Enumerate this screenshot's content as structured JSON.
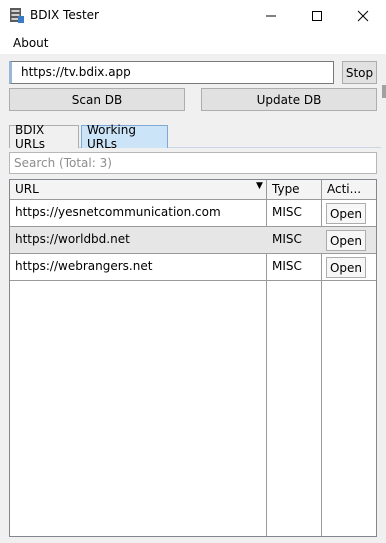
{
  "window": {
    "title": "BDIX Tester",
    "controls": {
      "minimize": "–",
      "maximize": "☐",
      "close": "✕"
    }
  },
  "menu": {
    "about": "About"
  },
  "url_bar": {
    "value": "https://tv.bdix.app",
    "stop_label": "Stop"
  },
  "actions": {
    "scan_label": "Scan DB",
    "update_label": "Update DB"
  },
  "tabs": [
    {
      "label": "BDIX URLs",
      "selected": false
    },
    {
      "label": "Working URLs",
      "selected": true
    }
  ],
  "search": {
    "placeholder": "Search (Total: 3)"
  },
  "table": {
    "columns": [
      "URL",
      "Type",
      "Acti..."
    ],
    "sort_indicator": "▼",
    "rows": [
      {
        "url": "https://yesnetcommunication.com",
        "type": "MISC",
        "action": "Open"
      },
      {
        "url": "https://worldbd.net",
        "type": "MISC",
        "action": "Open"
      },
      {
        "url": "https://webrangers.net",
        "type": "MISC",
        "action": "Open"
      }
    ]
  },
  "colors": {
    "selected_tab": "#cce4f7",
    "alt_row": "#e6e6e6"
  }
}
